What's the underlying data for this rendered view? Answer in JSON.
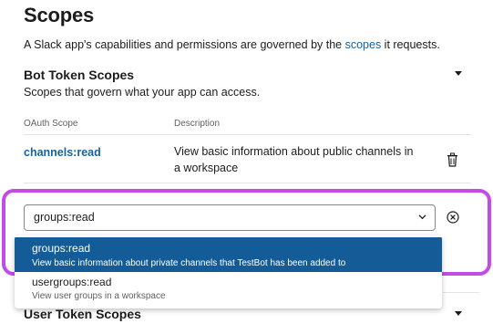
{
  "page": {
    "heading": "Scopes",
    "intro_prefix": "A Slack app's capabilities and permissions are governed by the ",
    "intro_link": "scopes",
    "intro_suffix": " it requests."
  },
  "bot_section": {
    "title": "Bot Token Scopes",
    "subtitle": "Scopes that govern what your app can access.",
    "columns": {
      "scope": "OAuth Scope",
      "description": "Description"
    },
    "rows": [
      {
        "scope": "channels:read",
        "description": "View basic information about public channels in a workspace"
      }
    ]
  },
  "scope_select": {
    "value": "groups:read",
    "options": [
      {
        "name": "groups:read",
        "description": "View basic information about private channels that TestBot has been added to"
      },
      {
        "name": "usergroups:read",
        "description": "View user groups in a workspace"
      }
    ]
  },
  "user_section": {
    "title": "User Token Scopes"
  },
  "icons": {
    "collapse": "caret-down-icon",
    "delete": "trash-icon",
    "clear": "circle-x-icon",
    "chevron": "chevron-down-icon"
  },
  "colors": {
    "link": "#1264a3",
    "option_highlight": "#135c98",
    "focus_frame": "#c24de6"
  }
}
